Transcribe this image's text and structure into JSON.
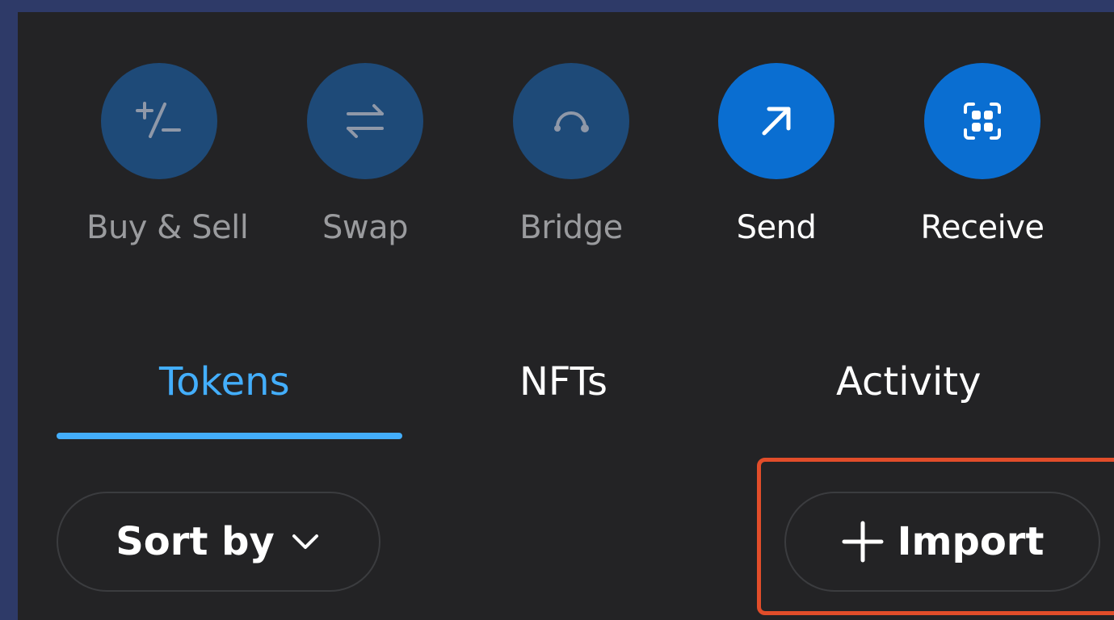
{
  "actions": [
    {
      "label": "Buy & Sell",
      "icon": "plus-minus-icon",
      "state": "disabled"
    },
    {
      "label": "Swap",
      "icon": "swap-arrows-icon",
      "state": "disabled"
    },
    {
      "label": "Bridge",
      "icon": "bridge-icon",
      "state": "disabled"
    },
    {
      "label": "Send",
      "icon": "arrow-up-right-icon",
      "state": "enabled"
    },
    {
      "label": "Receive",
      "icon": "qr-code-icon",
      "state": "enabled"
    }
  ],
  "tabs": [
    {
      "label": "Tokens",
      "active": true
    },
    {
      "label": "NFTs",
      "active": false
    },
    {
      "label": "Activity",
      "active": false
    }
  ],
  "controls": {
    "sort_label": "Sort by",
    "import_label": "Import"
  },
  "colors": {
    "background": "#232325",
    "accent": "#43aefc",
    "button_enabled": "#0a6ed1",
    "button_disabled": "#1e4a78",
    "highlight": "#e14d2a"
  }
}
